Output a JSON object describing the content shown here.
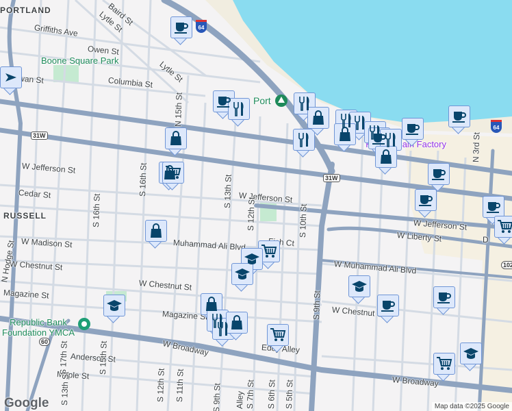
{
  "map": {
    "neighborhoods": [
      "PORTLAND",
      "RUSSELL"
    ],
    "parks": [
      {
        "name": "Boone Square Park"
      }
    ],
    "pois": [
      {
        "name": "Port"
      },
      {
        "name": "Republic Bank Foundation YMCA"
      },
      {
        "name": "Kroger Main Factory"
      }
    ],
    "streets": [
      "Baird St",
      "Lytle St",
      "Griffiths Ave",
      "Owen St",
      "Lytle St",
      "Rowan St",
      "Columbia St",
      "N 15th St",
      "W Jefferson St",
      "Cedar St",
      "S 16th St",
      "S 13th St",
      "W Jefferson St",
      "S 12th St",
      "S 10th St",
      "Fish Ct",
      "Muhammad Ali Blvd",
      "W Madison St",
      "W Chestnut St",
      "W Chestnut St",
      "Magazine St",
      "Magazine St",
      "W Muhammad Ali Blvd",
      "W Jefferson St",
      "W Liberty St",
      "W Chestnut St",
      "S 9th St",
      "W Broadway",
      "W Broadway",
      "Anderson St",
      "Maple St",
      "S 17th St",
      "S 15th St",
      "S 12th St",
      "S 11th St",
      "S 9th St",
      "S 7th St",
      "S 6th St",
      "S 5th St",
      "N 3rd St",
      "Alley",
      "Eddy Alley",
      "S 13th St",
      "S 16th St",
      "N Hodge St",
      "D"
    ],
    "route_shields": [
      "31W",
      "31W",
      "60",
      "64",
      "64",
      "102"
    ],
    "markers": [
      "cafe",
      "cafe",
      "restaurant",
      "shopping",
      "shopping",
      "restaurant",
      "restaurant",
      "shopping",
      "restaurant",
      "restaurant",
      "shopping",
      "restaurant",
      "cafe",
      "restaurant",
      "shopping",
      "cafe",
      "cafe",
      "cafe",
      "cafe",
      "cafe",
      "grocery",
      "grocery",
      "shopping",
      "grocery",
      "school",
      "school",
      "school",
      "school",
      "shopping",
      "restaurant",
      "restaurant",
      "shopping",
      "grocery",
      "cafe",
      "cafe",
      "grocery",
      "school",
      "arrow"
    ],
    "attribution": "Map data ©2025 Google",
    "logo": "Google"
  },
  "colors": {
    "water": "#8adcf0",
    "highway": "#8ea3bf",
    "road": "#d4dbe4",
    "land": "#f4f3f4",
    "marker_icon": "#08456b",
    "marker_bg": "#dde8fb"
  }
}
